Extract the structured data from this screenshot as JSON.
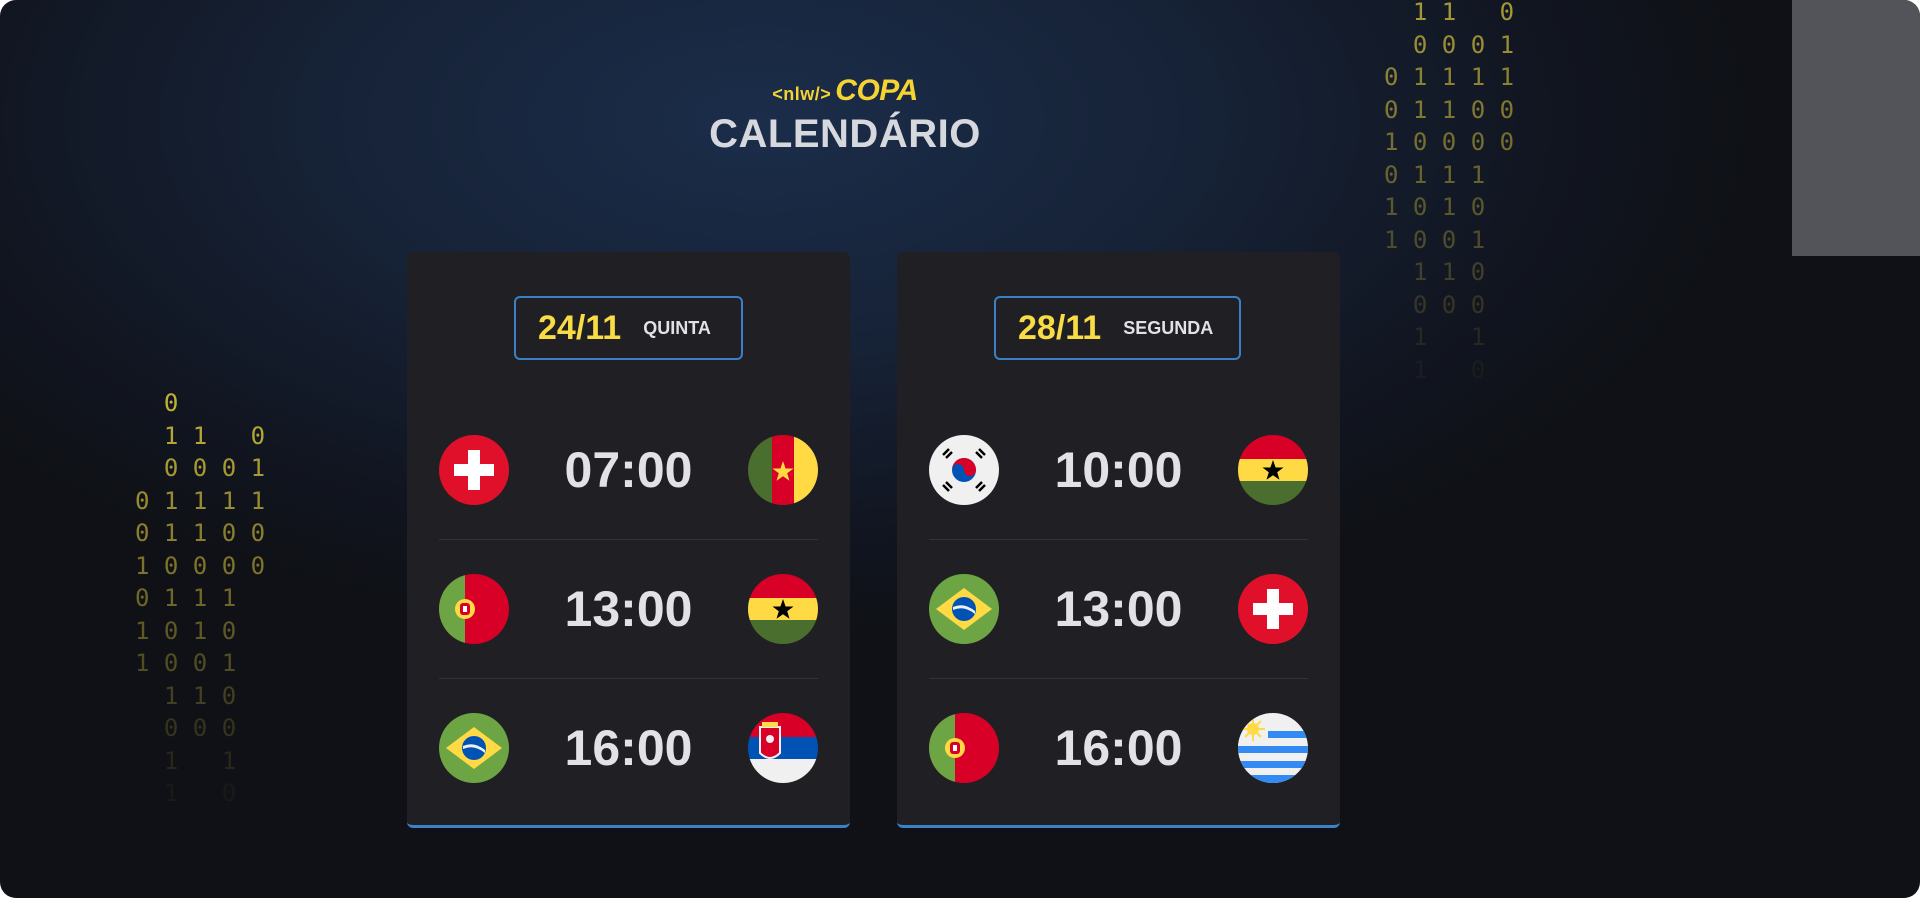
{
  "header": {
    "logo_tag": "<nlw/>",
    "logo_name": "COPA",
    "title": "CALENDÁRIO"
  },
  "decorations": {
    "matrix_left": [
      "  0",
      "  1 1   0",
      "  0 0 0 1",
      "0 1 1 1 1",
      "0 1 1 0 0",
      "1 0 0 0 0",
      "0 1 1 1",
      "1 0 1 0",
      "1 0 0 1",
      "  1 1 0",
      "  0 0 0",
      "  1   1",
      "  1   0"
    ],
    "matrix_right": [
      "  1 1   0",
      "  0 0 0 1",
      "0 1 1 1 1",
      "0 1 1 0 0",
      "1 0 0 0 0",
      "0 1 1 1",
      "1 0 1 0",
      "1 0 0 1",
      "  1 1 0",
      "  0 0 0",
      "  1   1",
      "  1   0"
    ]
  },
  "cards": [
    {
      "date": "24/11",
      "weekday": "QUINTA",
      "matches": [
        {
          "time": "07:00",
          "home_flag": "switzerland-flag-icon",
          "away_flag": "cameroon-flag-icon"
        },
        {
          "time": "13:00",
          "home_flag": "portugal-flag-icon",
          "away_flag": "ghana-flag-icon"
        },
        {
          "time": "16:00",
          "home_flag": "brazil-flag-icon",
          "away_flag": "serbia-flag-icon"
        }
      ]
    },
    {
      "date": "28/11",
      "weekday": "SEGUNDA",
      "matches": [
        {
          "time": "10:00",
          "home_flag": "south-korea-flag-icon",
          "away_flag": "ghana-flag-icon"
        },
        {
          "time": "13:00",
          "home_flag": "brazil-flag-icon",
          "away_flag": "switzerland-flag-icon"
        },
        {
          "time": "16:00",
          "home_flag": "portugal-flag-icon",
          "away_flag": "uruguay-flag-icon"
        }
      ]
    }
  ],
  "colors": {
    "accent_yellow": "#f7dd43",
    "accent_blue": "#3b80c7",
    "card_bg": "#202024",
    "text": "#e1e1e6"
  }
}
